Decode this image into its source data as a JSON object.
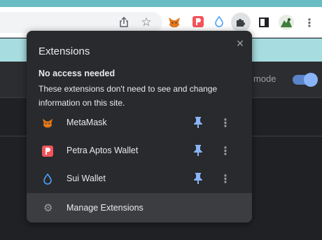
{
  "toolbar": {
    "share_icon": "share-icon",
    "star_icon": "star-icon",
    "puzzle_icon": "puzzle-icon",
    "sidepanel_icon": "side-panel-icon",
    "menu_icon": "menu-kebab-icon",
    "menu_glyph": "⋮",
    "star_glyph": "☆"
  },
  "page": {
    "dark_mode_label": "r mode",
    "toggle_on": true,
    "accent": "#8ab4f8"
  },
  "popup": {
    "title": "Extensions",
    "close_glyph": "✕",
    "section_title": "No access needed",
    "section_desc": "These extensions don't need to see and change information on this site.",
    "extensions": [
      {
        "name": "MetaMask",
        "icon": "metamask-fox-icon",
        "pinned": true
      },
      {
        "name": "Petra Aptos Wallet",
        "icon": "petra-icon",
        "pinned": true
      },
      {
        "name": "Sui Wallet",
        "icon": "sui-droplet-icon",
        "pinned": true
      }
    ],
    "more_glyph": "⋮",
    "manage_label": "Manage Extensions",
    "manage_glyph": "⚙"
  },
  "colors": {
    "popup_bg": "#292a2d",
    "pin": "#8ab4f8",
    "petra": "#f2545b",
    "metamask": "#e2761b",
    "sui": "#4da2ff"
  }
}
